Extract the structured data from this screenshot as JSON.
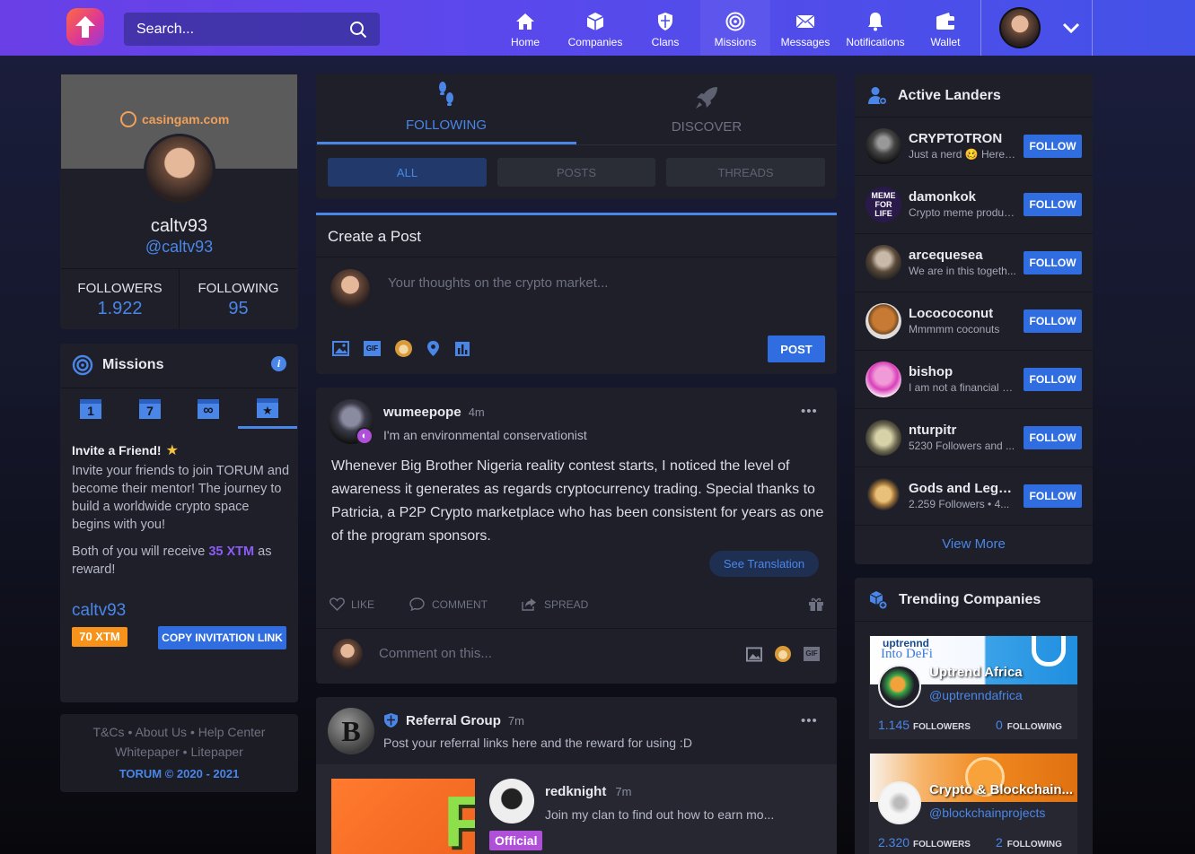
{
  "topbar": {
    "search_placeholder": "Search...",
    "nav": [
      {
        "label": "Home",
        "icon": "home-icon"
      },
      {
        "label": "Companies",
        "icon": "companies-icon"
      },
      {
        "label": "Clans",
        "icon": "clans-icon"
      },
      {
        "label": "Missions",
        "icon": "missions-icon"
      },
      {
        "label": "Messages",
        "icon": "messages-icon"
      },
      {
        "label": "Notifications",
        "icon": "notifications-icon"
      },
      {
        "label": "Wallet",
        "icon": "wallet-icon"
      }
    ]
  },
  "profile": {
    "banner_text": "casingam.com",
    "name": "caltv93",
    "handle": "@caltv93",
    "followers_label": "FOLLOWERS",
    "followers": "1.922",
    "following_label": "FOLLOWING",
    "following": "95"
  },
  "missions": {
    "title": "Missions",
    "tab_numbers": [
      "1",
      "7"
    ],
    "task_title": "Invite a Friend!",
    "task_desc": "Invite your friends to join TORUM and become their mentor! The journey to build a worldwide crypto space begins with you!",
    "reward_prefix": "Both of you will receive",
    "reward_amount": "35 XTM",
    "reward_suffix": "as reward!",
    "username": "caltv93",
    "xtm_badge": "70 XTM",
    "copy_button": "COPY INVITATION LINK"
  },
  "footer": {
    "links1": [
      "T&Cs",
      "About Us",
      "Help Center"
    ],
    "links2": [
      "Whitepaper",
      "Litepaper"
    ],
    "copyright": "TORUM © 2020 - 2021"
  },
  "feed": {
    "tabs": [
      {
        "label": "FOLLOWING"
      },
      {
        "label": "DISCOVER"
      }
    ],
    "filters": [
      "ALL",
      "POSTS",
      "THREADS"
    ],
    "create_title": "Create a Post",
    "composer_placeholder": "Your thoughts on the crypto market...",
    "post_button": "POST",
    "gif_label": "GIF"
  },
  "post1": {
    "author": "wumeepope",
    "time": "4m",
    "bio": "I'm an environmental conservationist",
    "body": "Whenever Big Brother Nigeria reality contest starts, I noticed the level of awareness it generates as regards cryptocurrency trading. Special thanks to Patricia, a P2P Crypto marketplace who has been consistent for years as one of the program sponsors.",
    "translate": "See Translation",
    "like": "LIKE",
    "comment": "COMMENT",
    "spread": "SPREAD",
    "comment_placeholder": "Comment on this...",
    "more": "•••"
  },
  "post2": {
    "group": "Referral Group",
    "time": "7m",
    "desc": "Post your referral links here and the reward for using :D",
    "more": "•••",
    "inner_author": "redknight",
    "inner_time": "7m",
    "inner_text": "Join my clan to find out how to earn mo...",
    "badge": "Official",
    "thumb_letter": "F"
  },
  "landers": {
    "title": "Active Landers",
    "follow_label": "FOLLOW",
    "items": [
      {
        "name": "CRYPTOTRON",
        "desc": "Just a nerd 🥴 Here ..."
      },
      {
        "name": "damonkok",
        "desc": "Crypto meme produc..."
      },
      {
        "name": "arcequesea",
        "desc": "We are in this togeth..."
      },
      {
        "name": "Locococonut",
        "desc": "Mmmmm coconuts"
      },
      {
        "name": "bishop",
        "desc": "I am not a financial a..."
      },
      {
        "name": "nturpitr",
        "desc": "5230 Followers and ..."
      },
      {
        "name": "Gods and Legen...",
        "desc": "2.259 Followers  •  4..."
      }
    ],
    "view_more": "View More"
  },
  "trending": {
    "title": "Trending Companies",
    "companies": [
      {
        "banner_title": "Into DeFi",
        "banner_brand": "uptrennd",
        "banner_overlay": "Uptrend Africa",
        "handle": "@uptrenndafrica",
        "followers": "1.145",
        "following": "0"
      },
      {
        "banner_overlay": "Crypto & Blockchain...",
        "handle": "@blockchainprojects",
        "followers": "2.320",
        "following": "2"
      }
    ],
    "followers_label": "FOLLOWERS",
    "following_label": "FOLLOWING"
  },
  "colors": {
    "accent": "#4a86e8",
    "button": "#2f6de0",
    "xtm": "#f7931a",
    "reward": "#8c5cf6",
    "official": "#b04fd8"
  }
}
